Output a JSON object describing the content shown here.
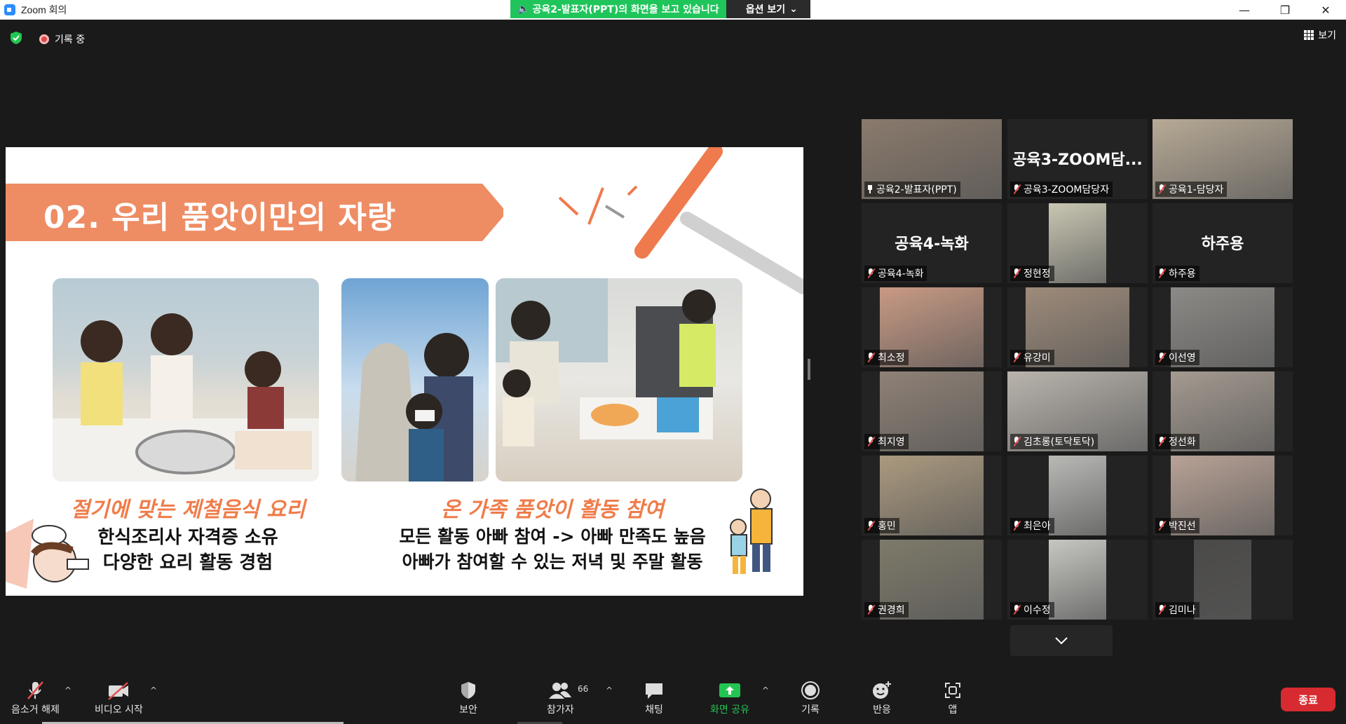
{
  "window": {
    "title": "Zoom 회의",
    "share_banner": "공육2-발표자(PPT)의 화면을 보고 있습니다",
    "options_label": "옵션 보기"
  },
  "topbar": {
    "recording_label": "기록 중",
    "view_label": "보기"
  },
  "slide": {
    "heading": "02. 우리 품앗이만의 자랑",
    "left_caption_title": "절기에 맞는 제철음식 요리",
    "left_caption_lines": [
      "한식조리사 자격증 소유",
      "다양한 요리 활동 경험"
    ],
    "right_caption_title": "온 가족 품앗이 활동 참여",
    "right_caption_lines": [
      "모든 활동 아빠 참여 -> 아빠 만족도 높음",
      "아빠가 참여할 수 있는 저녁 및 주말 활동"
    ]
  },
  "participants": [
    {
      "name": "공육2-발표자(PPT)",
      "big": "",
      "active": true,
      "pinned": true,
      "bg": "#8a7a6c"
    },
    {
      "name": "공육3-ZOOM담당자",
      "big": "공육3-ZOOM담...",
      "active": false,
      "pinned": false,
      "bg": ""
    },
    {
      "name": "공육1-담당자",
      "big": "",
      "active": false,
      "pinned": false,
      "bg": "#b7aa96"
    },
    {
      "name": "공육4-녹화",
      "big": "공육4-녹화",
      "active": false,
      "pinned": false,
      "bg": ""
    },
    {
      "name": "정현정",
      "big": "",
      "active": false,
      "pinned": false,
      "bg": "#c9c6b2"
    },
    {
      "name": "하주용",
      "big": "하주용",
      "active": false,
      "pinned": false,
      "bg": ""
    },
    {
      "name": "최소정",
      "big": "",
      "active": false,
      "pinned": false,
      "bg": "#c99a84"
    },
    {
      "name": "유강미",
      "big": "",
      "active": false,
      "pinned": false,
      "bg": "#9e8b7a"
    },
    {
      "name": "이선영",
      "big": "",
      "active": false,
      "pinned": false,
      "bg": "#8c8a86"
    },
    {
      "name": "최지영",
      "big": "",
      "active": false,
      "pinned": false,
      "bg": "#8f8176"
    },
    {
      "name": "김초롱(토닥토닥)",
      "big": "",
      "active": false,
      "pinned": false,
      "bg": "#b9b4ad"
    },
    {
      "name": "정선화",
      "big": "",
      "active": false,
      "pinned": false,
      "bg": "#a49a90"
    },
    {
      "name": "홍민",
      "big": "",
      "active": false,
      "pinned": false,
      "bg": "#ab9a7f"
    },
    {
      "name": "최은아",
      "big": "",
      "active": false,
      "pinned": false,
      "bg": "#b9b9b6"
    },
    {
      "name": "박진선",
      "big": "",
      "active": false,
      "pinned": false,
      "bg": "#b8a296"
    },
    {
      "name": "권경희",
      "big": "",
      "active": false,
      "pinned": false,
      "bg": "#7e7a6a"
    },
    {
      "name": "이수정",
      "big": "",
      "active": false,
      "pinned": false,
      "bg": "#c7c7c2"
    },
    {
      "name": "김미나",
      "big": "",
      "active": false,
      "pinned": false,
      "bg": "#4b4a48"
    }
  ],
  "toolbar": {
    "mute_label": "음소거 해제",
    "video_label": "비디오 시작",
    "security_label": "보안",
    "participants_label": "참가자",
    "participants_count": "66",
    "chat_label": "채팅",
    "share_label": "화면 공유",
    "record_label": "기록",
    "reactions_label": "반응",
    "apps_label": "앱",
    "end_label": "종료"
  },
  "colors": {
    "share_green": "#1fc55a",
    "slide_orange": "#ee8c64",
    "active_speaker": "#c6e43a",
    "end_red": "#d82b31"
  }
}
